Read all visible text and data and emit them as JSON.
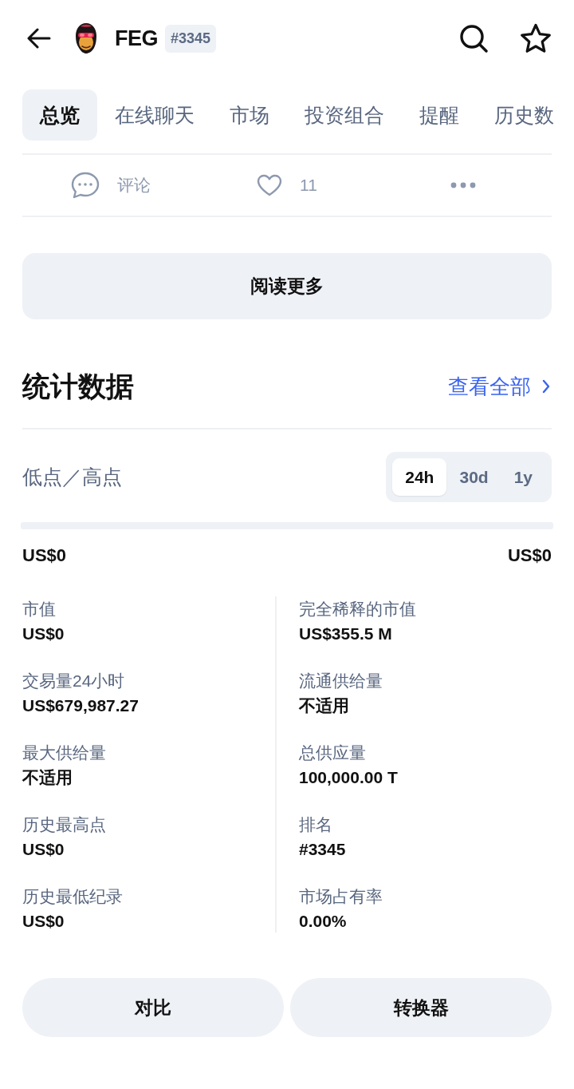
{
  "header": {
    "title": "FEG",
    "rank_badge": "#3345"
  },
  "tabs": [
    {
      "label": "总览",
      "selected": true
    },
    {
      "label": "在线聊天",
      "selected": false
    },
    {
      "label": "市场",
      "selected": false
    },
    {
      "label": "投资组合",
      "selected": false
    },
    {
      "label": "提醒",
      "selected": false
    },
    {
      "label": "历史数",
      "selected": false
    }
  ],
  "actions": {
    "comment_label": "评论",
    "like_count": "11"
  },
  "read_more_button": "阅读更多",
  "stats_section": {
    "title": "统计数据",
    "view_all_link": "查看全部"
  },
  "range": {
    "label": "低点／高点",
    "periods": [
      {
        "label": "24h",
        "selected": true
      },
      {
        "label": "30d",
        "selected": false
      },
      {
        "label": "1y",
        "selected": false
      }
    ],
    "low": "US$0",
    "high": "US$0"
  },
  "stats": {
    "columns": [
      {
        "items": [
          {
            "label": "市值",
            "value": "US$0"
          },
          {
            "label": "交易量24小时",
            "value": "US$679,987.27"
          },
          {
            "label": "最大供给量",
            "value": "不适用"
          },
          {
            "label": "历史最高点",
            "value": "US$0"
          },
          {
            "label": "历史最低纪录",
            "value": "US$0"
          }
        ]
      },
      {
        "items": [
          {
            "label": "完全稀释的市值",
            "value": "US$355.5 M"
          },
          {
            "label": "流通供给量",
            "value": "不适用"
          },
          {
            "label": "总供应量",
            "value": "100,000.00 T"
          },
          {
            "label": "排名",
            "value": "#3345"
          },
          {
            "label": "市场占有率",
            "value": "0.00%"
          }
        ]
      }
    ]
  },
  "buttons": [
    "对比",
    "转换器"
  ]
}
